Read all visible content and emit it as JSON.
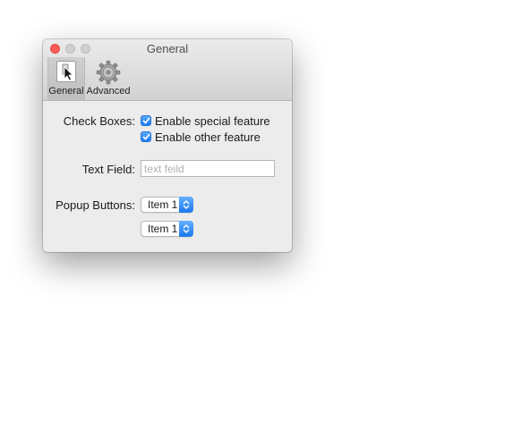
{
  "window": {
    "title": "General"
  },
  "toolbar": {
    "items": [
      {
        "label": "General",
        "icon": "general-prefs-icon",
        "selected": true
      },
      {
        "label": "Advanced",
        "icon": "gear-icon",
        "selected": false
      }
    ]
  },
  "form": {
    "checkboxes_label": "Check Boxes:",
    "checkboxes": [
      {
        "label": "Enable special feature",
        "checked": true
      },
      {
        "label": "Enable other feature",
        "checked": true
      }
    ],
    "text_field_label": "Text Field:",
    "text_field": {
      "value": "",
      "placeholder": "text feild"
    },
    "popups_label": "Popup Buttons:",
    "popups": [
      {
        "selected": "Item 1"
      },
      {
        "selected": "Item 1"
      }
    ]
  },
  "colors": {
    "accent": "#1b7cf5",
    "close_button": "#fc5b57"
  }
}
